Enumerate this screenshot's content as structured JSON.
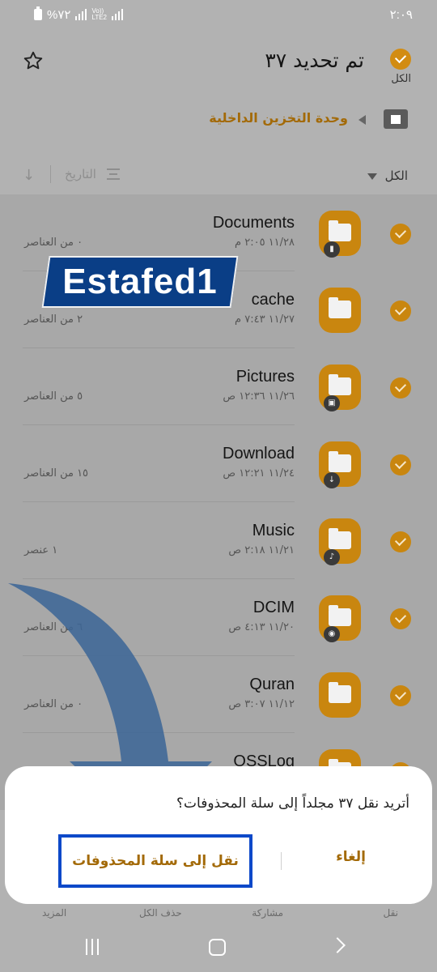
{
  "status": {
    "time": "٢:٠٩",
    "battery": "%٧٢",
    "network_top": "Vo))",
    "network_bottom": "LTE2"
  },
  "header": {
    "title": "تم تحديد ٣٧",
    "select_all_label": "الكل",
    "breadcrumb": "وحدة التخزين الداخلية",
    "filter_label": "الكل",
    "sort_label": "التاريخ"
  },
  "folders": [
    {
      "name": "Documents",
      "date": "١١/٢٨ ٢:٠٥ م",
      "count": "٠ من العناصر",
      "badge": "doc-badge-icon",
      "badge_glyph": "▮"
    },
    {
      "name": "cache",
      "date": "١١/٢٧ ٧:٤٣ م",
      "count": "٢ من العناصر",
      "badge": "",
      "badge_glyph": ""
    },
    {
      "name": "Pictures",
      "date": "١١/٢٦ ١٢:٣٦ ص",
      "count": "٥ من العناصر",
      "badge": "image-badge-icon",
      "badge_glyph": "▣"
    },
    {
      "name": "Download",
      "date": "١١/٢٤ ١٢:٢١ ص",
      "count": "١٥ من العناصر",
      "badge": "download-badge-icon",
      "badge_glyph": "↓"
    },
    {
      "name": "Music",
      "date": "١١/٢١ ٢:١٨ ص",
      "count": "١ عنصر",
      "badge": "music-badge-icon",
      "badge_glyph": "♪"
    },
    {
      "name": "DCIM",
      "date": "١١/٢٠ ٤:١٣ ص",
      "count": "٦ من العناصر",
      "badge": "camera-badge-icon",
      "badge_glyph": "◉"
    },
    {
      "name": "Quran",
      "date": "١١/١٢ ٣:٠٧ ص",
      "count": "٠ من العناصر",
      "badge": "",
      "badge_glyph": ""
    },
    {
      "name": "OSSLog",
      "date": "",
      "count": "",
      "badge": "",
      "badge_glyph": ""
    }
  ],
  "watermark": "Estafed1",
  "dialog": {
    "message": "أتريد نقل ٣٧ مجلداً إلى سلة المحذوفات؟",
    "cancel_label": "إلغاء",
    "confirm_label": "نقل إلى سلة المحذوفات"
  },
  "bottom_bar": {
    "move": "نقل",
    "share": "مشاركة",
    "delete": "حذف الكل",
    "more": "المزيد"
  },
  "colors": {
    "accent": "#c9860f",
    "accent_text": "#a36a08",
    "highlight_border": "#0d49c9",
    "watermark_bg": "#0a3e86",
    "arrow": "#3d6796"
  }
}
